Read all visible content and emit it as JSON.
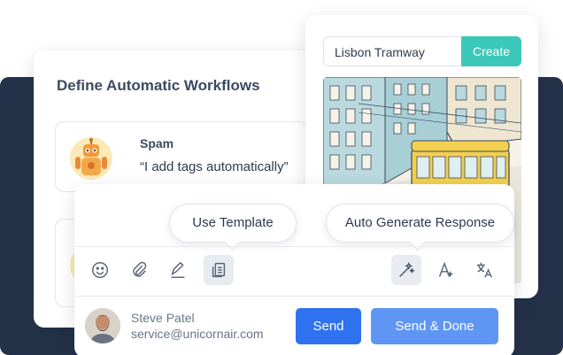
{
  "workflow": {
    "title": "Define Automatic Workflows",
    "item": {
      "title": "Spam",
      "quote": "“I add tags automatically”"
    }
  },
  "image_generator": {
    "search_value": "Lisbon Tramway",
    "create_label": "Create"
  },
  "composer": {
    "tooltips": {
      "template": "Use Template",
      "auto": "Auto Generate Response"
    },
    "tools": [
      "emoji-icon",
      "paperclip-icon",
      "signature-pen-icon",
      "template-document-icon",
      "magic-wand-icon",
      "text-format-icon",
      "translate-icon"
    ],
    "agent": {
      "name": "Steve Patel",
      "email": "service@unicornair.com"
    },
    "send_label": "Send",
    "send_done_label": "Send & Done"
  },
  "colors": {
    "navy_background": "#243249",
    "create_teal": "#3cc8b8",
    "send_blue": "#2f72f0",
    "send_done_blue": "#5f96f4"
  }
}
